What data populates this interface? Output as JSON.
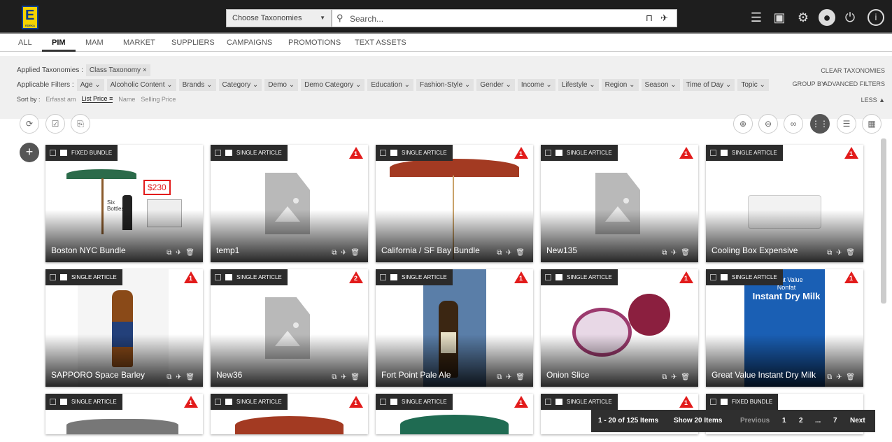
{
  "app": {
    "logo_text": "E",
    "logo_subtext": "EDEKA"
  },
  "header": {
    "taxonomy_select": "Choose Taxonomies",
    "search_placeholder": "Search...",
    "icons": [
      "checklist-icon",
      "calendar-icon",
      "gear-icon",
      "user-avatar-icon",
      "power-icon",
      "info-icon"
    ]
  },
  "tabs": [
    {
      "label": "ALL"
    },
    {
      "label": "PIM"
    },
    {
      "label": "MAM"
    },
    {
      "label": "MARKET"
    },
    {
      "label": "SUPPLIERS"
    },
    {
      "label": "CAMPAIGNS"
    },
    {
      "label": "PROMOTIONS"
    },
    {
      "label": "TEXT ASSETS"
    }
  ],
  "active_tab": "PIM",
  "filters": {
    "applied_label": "Applied Taxonomies :",
    "applied_chip": "Class Taxonomy",
    "applicable_label": "Applicable Filters :",
    "applicable": [
      "Age",
      "Alcoholic Content",
      "Brands",
      "Category",
      "Demo",
      "Demo Category",
      "Education",
      "Fashion-Style",
      "Gender",
      "Income",
      "Lifestyle",
      "Region",
      "Season",
      "Time of Day",
      "Topic"
    ],
    "sort_label": "Sort by :",
    "sort_options": [
      "Erfasst am",
      "List Price",
      "Name",
      "Selling Price"
    ],
    "sort_active": "List Price",
    "clear": "CLEAR TAXONOMIES",
    "group_by": "GROUP BY",
    "advanced": "ADVANCED FILTERS",
    "less": "LESS"
  },
  "cards": [
    {
      "type": "FIXED BUNDLE",
      "name": "Boston NYC Bundle",
      "warn": ""
    },
    {
      "type": "SINGLE ARTICLE",
      "name": "temp1",
      "warn": "1"
    },
    {
      "type": "SINGLE ARTICLE",
      "name": "California / SF Bay Bundle",
      "warn": "1"
    },
    {
      "type": "SINGLE ARTICLE",
      "name": "New135",
      "warn": "1"
    },
    {
      "type": "SINGLE ARTICLE",
      "name": "Cooling Box Expensive",
      "warn": "1"
    },
    {
      "type": "SINGLE ARTICLE",
      "name": "SAPPORO Space Barley",
      "warn": "1"
    },
    {
      "type": "SINGLE ARTICLE",
      "name": "New36",
      "warn": "2"
    },
    {
      "type": "SINGLE ARTICLE",
      "name": "Fort Point Pale Ale",
      "warn": "1"
    },
    {
      "type": "SINGLE ARTICLE",
      "name": "Onion Slice",
      "warn": "1"
    },
    {
      "type": "SINGLE ARTICLE",
      "name": "Great Value Instant Dry Milk",
      "warn": "1"
    },
    {
      "type": "SINGLE ARTICLE",
      "name": "",
      "warn": "1"
    },
    {
      "type": "SINGLE ARTICLE",
      "name": "",
      "warn": "1"
    },
    {
      "type": "SINGLE ARTICLE",
      "name": "",
      "warn": "1"
    },
    {
      "type": "SINGLE ARTICLE",
      "name": "",
      "warn": "1"
    },
    {
      "type": "FIXED BUNDLE",
      "name": "",
      "warn": ""
    }
  ],
  "image_texts": {
    "price": "$230",
    "six": "Six",
    "bottles": "Bottles",
    "milk_brand": "Great Value",
    "milk_kind": "Nonfat",
    "milk_title": "Instant Dry Milk"
  },
  "pager": {
    "range": "1 - 20 of 125 Items",
    "show": "Show 20 Items",
    "previous": "Previous",
    "pages": [
      "1",
      "2",
      "...",
      "7"
    ],
    "next": "Next"
  }
}
